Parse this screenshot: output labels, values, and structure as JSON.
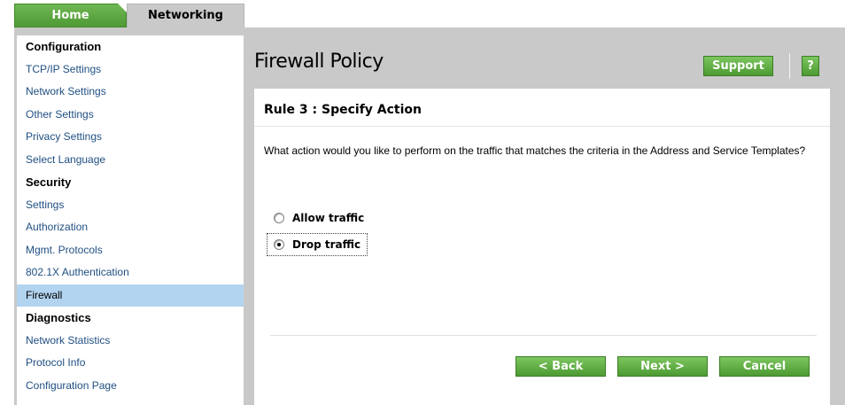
{
  "tabs": {
    "home": "Home",
    "networking": "Networking"
  },
  "sidebar": {
    "items": [
      {
        "label": "Configuration",
        "type": "header"
      },
      {
        "label": "TCP/IP Settings",
        "type": "link"
      },
      {
        "label": "Network Settings",
        "type": "link"
      },
      {
        "label": "Other Settings",
        "type": "link"
      },
      {
        "label": "Privacy Settings",
        "type": "link"
      },
      {
        "label": "Select Language",
        "type": "link"
      },
      {
        "label": "Security",
        "type": "header"
      },
      {
        "label": "Settings",
        "type": "link"
      },
      {
        "label": "Authorization",
        "type": "link"
      },
      {
        "label": "Mgmt. Protocols",
        "type": "link"
      },
      {
        "label": "802.1X Authentication",
        "type": "link"
      },
      {
        "label": "Firewall",
        "type": "link",
        "active": true
      },
      {
        "label": "Diagnostics",
        "type": "header"
      },
      {
        "label": "Network Statistics",
        "type": "link"
      },
      {
        "label": "Protocol Info",
        "type": "link"
      },
      {
        "label": "Configuration Page",
        "type": "link"
      }
    ]
  },
  "header": {
    "title": "Firewall Policy",
    "support_label": "Support",
    "help_label": "?"
  },
  "panel": {
    "title": "Rule 3 : Specify Action",
    "question": "What action would you like to perform on the traffic that matches the criteria in the Address and Service Templates?",
    "options": [
      {
        "label": "Allow traffic",
        "checked": false
      },
      {
        "label": "Drop traffic",
        "checked": true
      }
    ]
  },
  "buttons": {
    "back": "< Back",
    "next": "Next >",
    "cancel": "Cancel"
  },
  "colors": {
    "accent_green": "#5aa83e",
    "sidebar_link": "#1f4f82",
    "active_item": "#b3d4f1",
    "frame_gray": "#c9c9c9"
  }
}
